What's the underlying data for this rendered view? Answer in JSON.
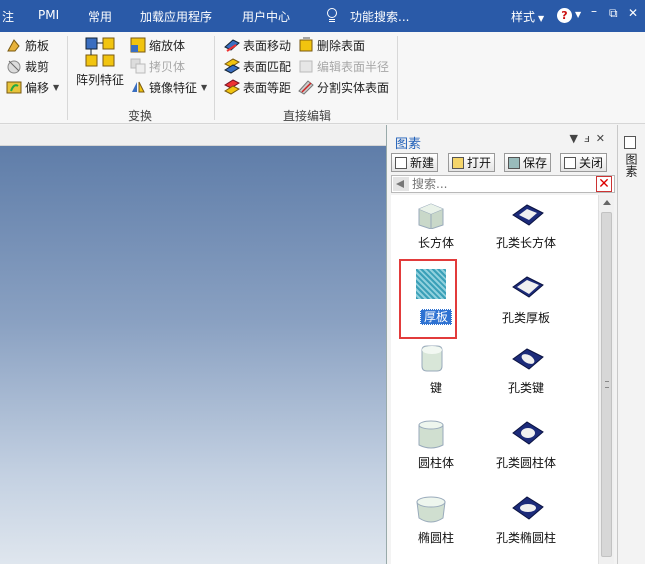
{
  "menubar": {
    "items": [
      "注",
      "PMI",
      "常用",
      "加载应用程序",
      "用户中心"
    ],
    "search_placeholder": "功能搜索...",
    "style_label": "样式",
    "help": "?"
  },
  "ribbon": {
    "col1": [
      "筋板",
      "裁剪",
      "偏移"
    ],
    "array": "阵列特征",
    "col2": [
      "缩放体",
      "拷贝体",
      "镜像特征"
    ],
    "col3": [
      "表面移动",
      "表面匹配",
      "表面等距"
    ],
    "col4": [
      "删除表面",
      "编辑表面半径",
      "分割实体表面"
    ],
    "groups": [
      "变换",
      "直接编辑"
    ]
  },
  "panel": {
    "title": "图素",
    "buttons": [
      "新建",
      "打开",
      "保存",
      "关闭"
    ],
    "search_placeholder": "搜索...",
    "items": [
      "长方体",
      "孔类长方体",
      "厚板",
      "孔类厚板",
      "键",
      "孔类键",
      "圆柱体",
      "孔类圆柱体",
      "椭圆柱",
      "孔类椭圆柱"
    ]
  },
  "strip": {
    "label": "图素"
  },
  "colors": {
    "menubar": "#2a5aa8",
    "selection": "#2e72d2",
    "highlight_frame": "#e23b3b"
  }
}
